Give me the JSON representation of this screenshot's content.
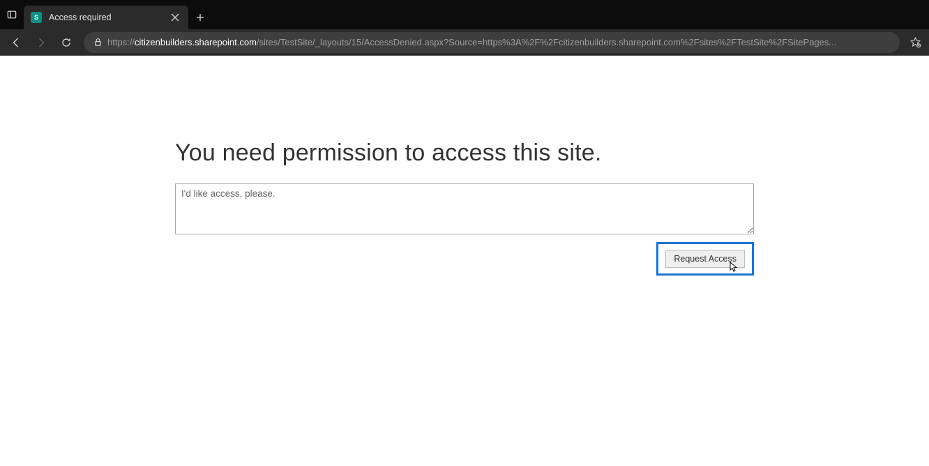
{
  "browser": {
    "tab": {
      "favicon_letter": "S",
      "title": "Access required"
    },
    "url": {
      "scheme": "https://",
      "host": "citizenbuilders.sharepoint.com",
      "path_display": "/sites/TestSite/_layouts/15/AccessDenied.aspx?Source=https%3A%2F%2Fcitizenbuilders.sharepoint.com%2Fsites%2FTestSite%2FSitePages..."
    }
  },
  "page": {
    "heading": "You need permission to access this site.",
    "message_placeholder": "I'd like access, please.",
    "request_button": "Request Access"
  }
}
